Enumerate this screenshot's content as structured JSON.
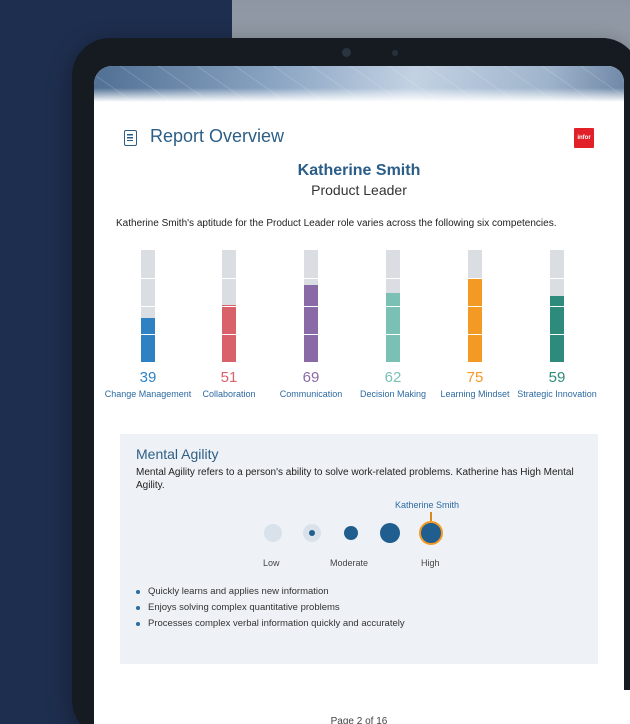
{
  "report": {
    "title": "Report Overview",
    "brand": "infor"
  },
  "candidate": {
    "name": "Katherine Smith",
    "role": "Product Leader"
  },
  "intro": "Katherine Smith's aptitude for the Product Leader role varies across the following six competencies.",
  "competencies": [
    {
      "label": "Change Management",
      "score": 39,
      "color": "#2e82c4"
    },
    {
      "label": "Collaboration",
      "score": 51,
      "color": "#d9626a"
    },
    {
      "label": "Communication",
      "score": 69,
      "color": "#8a6aa6"
    },
    {
      "label": "Decision Making",
      "score": 62,
      "color": "#7ac0b5"
    },
    {
      "label": "Learning Mindset",
      "score": 75,
      "color": "#f39a25"
    },
    {
      "label": "Strategic Innovation",
      "score": 59,
      "color": "#2e8a7a"
    }
  ],
  "mental_agility": {
    "title": "Mental Agility",
    "description": "Mental Agility refers to a person's ability to solve work-related problems. Katherine has High Mental Agility.",
    "candidate_marker": "Katherine Smith",
    "scale": [
      "Low",
      "Moderate",
      "High"
    ],
    "selected_level": "High",
    "bullets": [
      "Quickly learns and applies new information",
      "Enjoys solving complex quantitative problems",
      "Processes complex verbal information quickly and accurately"
    ]
  },
  "footer": {
    "page": "Page 2 of 16"
  }
}
